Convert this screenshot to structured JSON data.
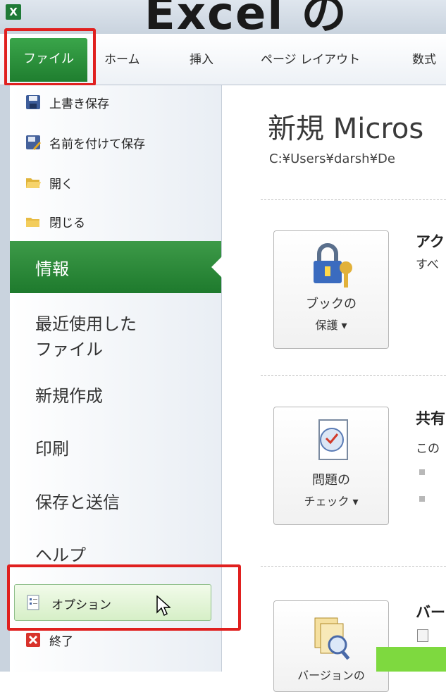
{
  "overlay": {
    "title": "Excel の"
  },
  "ribbon": {
    "file_tab": "ファイル",
    "tabs": [
      "ホーム",
      "挿入",
      "ページ レイアウト",
      "数式"
    ]
  },
  "backstage": {
    "commands": {
      "save": "上書き保存",
      "save_as": "名前を付けて保存",
      "open": "開く",
      "close": "閉じる"
    },
    "nav": {
      "info": "情報",
      "recent_line1": "最近使用した",
      "recent_line2": "ファイル",
      "new": "新規作成",
      "print": "印刷",
      "save_send": "保存と送信",
      "help": "ヘルプ",
      "options": "オプション",
      "exit": "終了"
    }
  },
  "main": {
    "doc_title": "新規 Micros",
    "doc_path": "C:¥Users¥darsh¥De",
    "sections": [
      {
        "button_line1": "ブックの",
        "button_line2": "保護 ▾",
        "heading": "アク",
        "text": "すべ"
      },
      {
        "button_line1": "問題の",
        "button_line2": "チェック ▾",
        "heading": "共有",
        "text": "この"
      },
      {
        "button_line1": "バージョンの",
        "heading": "バー"
      }
    ]
  },
  "colors": {
    "accent_green": "#1f7e2f",
    "highlight_red": "#e0201f",
    "corner_green": "#7ed93f"
  },
  "icons": [
    "excel-logo-icon",
    "save-icon",
    "save-as-icon",
    "open-folder-icon",
    "close-folder-icon",
    "lock-key-icon",
    "checklist-icon",
    "versions-icon",
    "options-icon",
    "exit-icon",
    "mouse-cursor-icon"
  ]
}
